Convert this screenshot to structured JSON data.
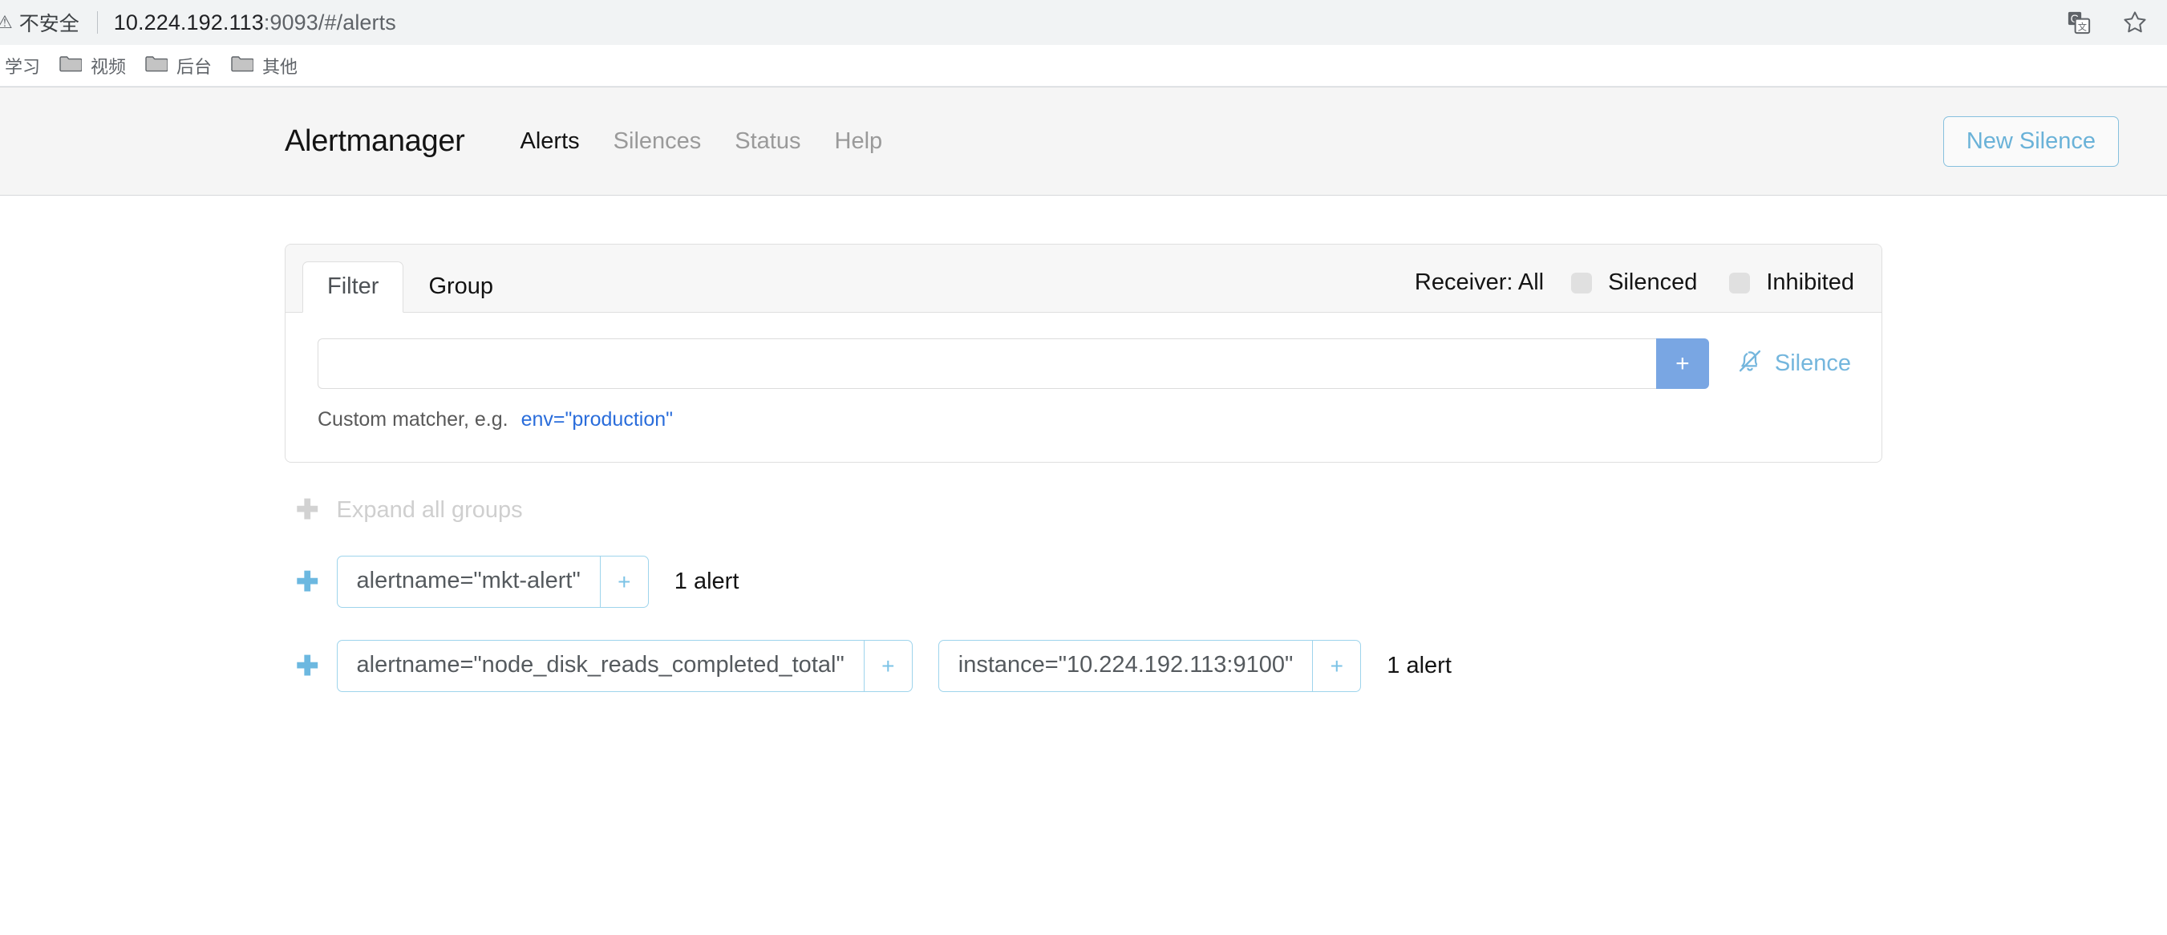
{
  "browser": {
    "security_label": "不安全",
    "url_main": "10.224.192.113",
    "url_port_path": ":9093/#/alerts",
    "translate_icon": "translate-icon",
    "bookmark_star_icon": "star-icon",
    "bookmarks": [
      {
        "label": "学习",
        "has_folder_icon": false
      },
      {
        "label": "视频",
        "has_folder_icon": true
      },
      {
        "label": "后台",
        "has_folder_icon": true
      },
      {
        "label": "其他",
        "has_folder_icon": true
      }
    ]
  },
  "navbar": {
    "brand": "Alertmanager",
    "links": [
      {
        "label": "Alerts",
        "active": true
      },
      {
        "label": "Silences",
        "active": false
      },
      {
        "label": "Status",
        "active": false
      },
      {
        "label": "Help",
        "active": false
      }
    ],
    "new_silence_label": "New Silence"
  },
  "filter_card": {
    "tabs": [
      {
        "label": "Filter",
        "active": true
      },
      {
        "label": "Group",
        "active": false
      }
    ],
    "receiver_label": "Receiver: All",
    "toggles": [
      {
        "label": "Silenced",
        "checked": false
      },
      {
        "label": "Inhibited",
        "checked": false
      }
    ],
    "matcher_input_value": "",
    "matcher_input_placeholder": "",
    "add_matcher_label": "+",
    "silence_label": "Silence",
    "silence_icon": "bell-slash-icon",
    "hint_text": "Custom matcher, e.g.",
    "hint_code": "env=\"production\""
  },
  "expand_all": {
    "label": "Expand all groups",
    "icon": "plus-icon"
  },
  "groups": [
    {
      "toggle_icon": "plus-icon",
      "matchers": [
        {
          "text": "alertname=\"mkt-alert\"",
          "add_label": "+"
        }
      ],
      "count_label": "1 alert"
    },
    {
      "toggle_icon": "plus-icon",
      "matchers": [
        {
          "text": "alertname=\"node_disk_reads_completed_total\"",
          "add_label": "+"
        },
        {
          "text": "instance=\"10.224.192.113:9100\"",
          "add_label": "+"
        }
      ],
      "count_label": "1 alert"
    }
  ],
  "colors": {
    "accent_blue": "#74b6dd",
    "button_blue": "#79a6e3",
    "link_blue": "#2a6ddb",
    "pill_border": "#9ed4ec",
    "navbar_bg": "#f5f5f5"
  }
}
